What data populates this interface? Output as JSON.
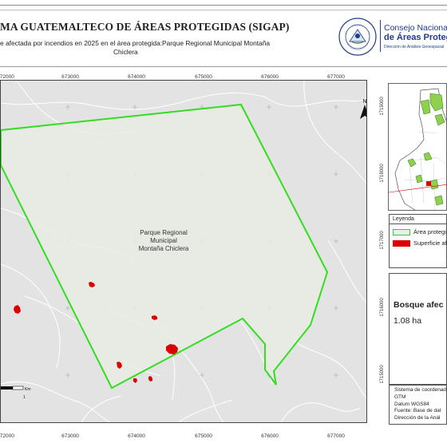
{
  "header": {
    "system_title": "MA GUATEMALTECO DE ÁREAS PROTEGIDAS  (SIGAP)",
    "subtitle_line1": "e afectada por incendios en 2025 en el área protegida:Parque Regional Municipal Montaña",
    "subtitle_line2": "Chiclera",
    "logo_line1": "Consejo Nacional",
    "logo_line2": "de Áreas Protegidas",
    "logo_line3": "Dirección de Análisis Geoespacial",
    "seal_text": "GOBIERNO DE LA REPÚBLICA · GUATEMALA"
  },
  "map": {
    "x_ticks": [
      "672000",
      "673000",
      "674000",
      "675000",
      "676000",
      "677000"
    ],
    "y_ticks": [
      "1719000",
      "1718000",
      "1717000",
      "1716000",
      "1715000"
    ],
    "area_label": [
      "Parque Regional",
      "Municipal",
      "Montaña Chiclera"
    ],
    "north_label": "N",
    "scale_unit": "Km",
    "scale_value": "1",
    "colors": {
      "background": "#e3e3e3",
      "area_fill": "#e7ece4",
      "area_outline": "#33dd22",
      "burn": "#dd0000",
      "roads": "#ffffff"
    }
  },
  "legend": {
    "title": "Leyenda",
    "items": [
      {
        "label": "Área protegi",
        "swatch": "area"
      },
      {
        "label": "Superficie af",
        "swatch": "burn"
      }
    ]
  },
  "forest": {
    "title": "Bosque afec",
    "value": "1.08 ha"
  },
  "metadata": {
    "lines": [
      "Sistema de coordenad",
      "GTM",
      "Datum WGS84",
      "Fuente: Base de dat",
      "Dirección de la Anál"
    ]
  }
}
